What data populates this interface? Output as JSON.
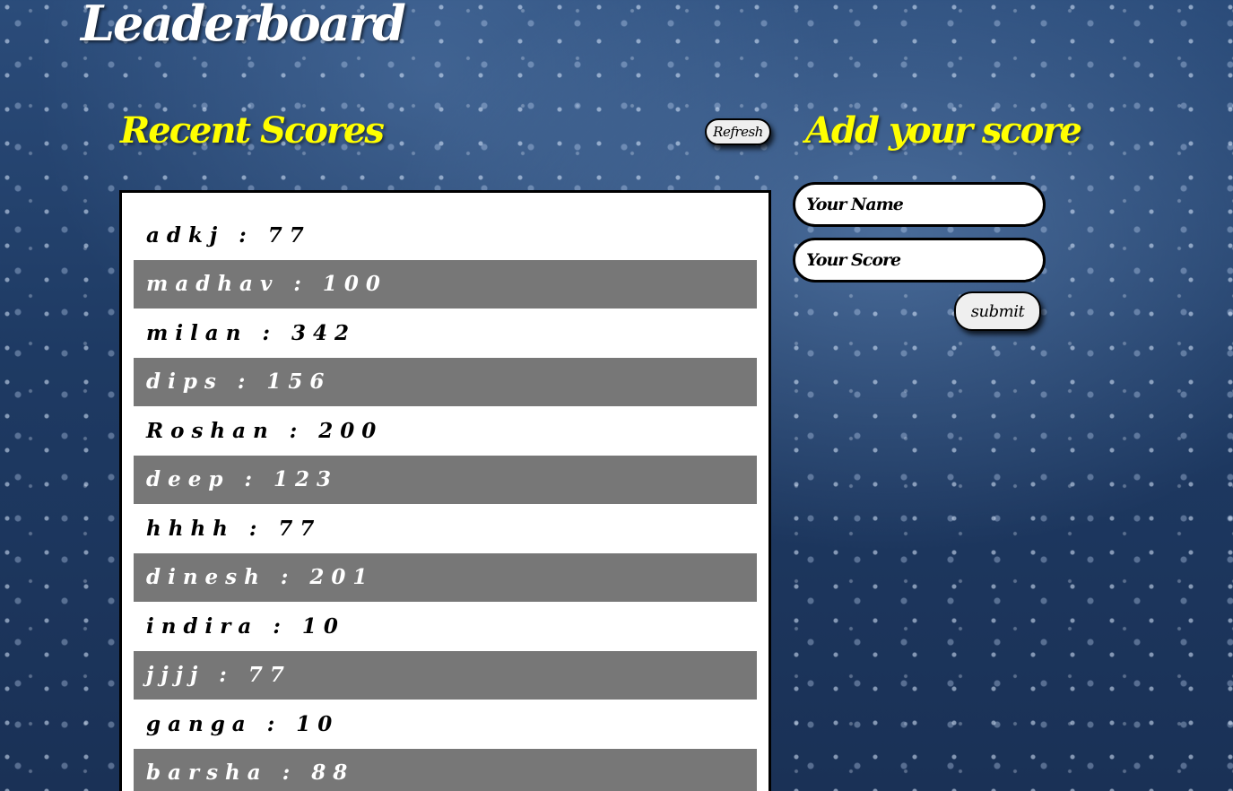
{
  "page": {
    "title": "Leaderboard"
  },
  "recent": {
    "title": "Recent Scores",
    "refresh_label": "Refresh",
    "scores": [
      {
        "name": "adkj",
        "score": "77"
      },
      {
        "name": "madhav",
        "score": "100"
      },
      {
        "name": "milan",
        "score": "342"
      },
      {
        "name": "dips",
        "score": "156"
      },
      {
        "name": "Roshan",
        "score": "200"
      },
      {
        "name": "deep",
        "score": "123"
      },
      {
        "name": "hhhh",
        "score": "77"
      },
      {
        "name": "dinesh",
        "score": "201"
      },
      {
        "name": "indira",
        "score": "10"
      },
      {
        "name": "jjjj",
        "score": "77"
      },
      {
        "name": "ganga",
        "score": "10"
      },
      {
        "name": "barsha",
        "score": "88"
      }
    ]
  },
  "add": {
    "title": "Add your score",
    "name_placeholder": "Your Name",
    "score_placeholder": "Your Score",
    "submit_label": "submit"
  },
  "colors": {
    "title_white": "#ffffff",
    "section_yellow": "#ffff00",
    "row_alt": "#777777",
    "panel_bg": "#ffffff"
  }
}
